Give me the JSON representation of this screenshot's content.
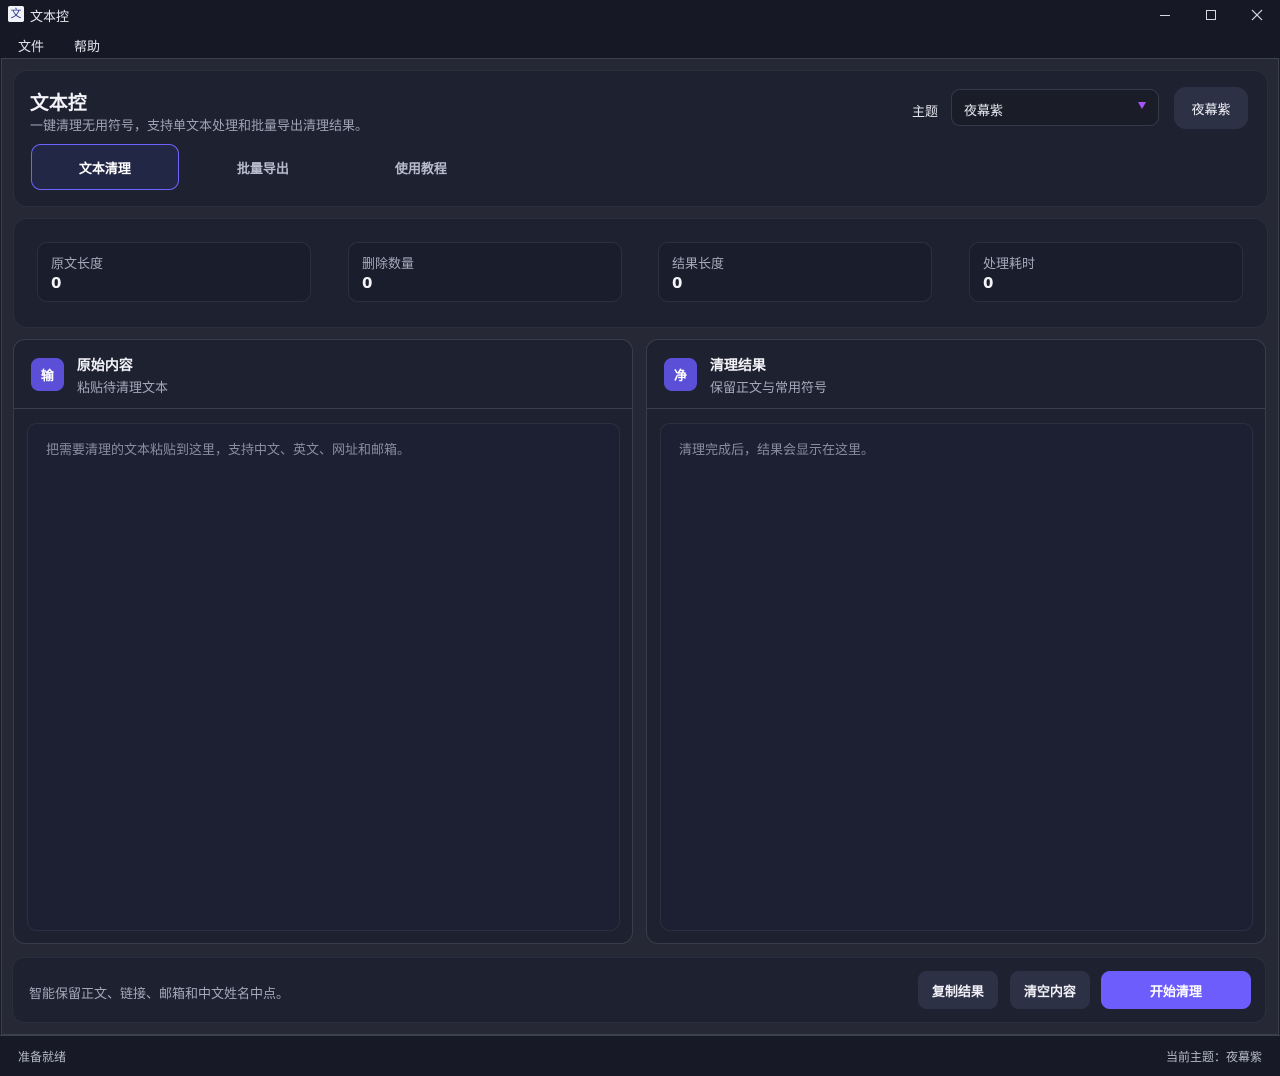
{
  "window": {
    "title": "文本控",
    "icon_glyph": "文"
  },
  "menu": {
    "items": [
      "文件",
      "帮助"
    ]
  },
  "header": {
    "title": "文本控",
    "subtitle": "一键清理无用符号，支持单文本处理和批量导出清理结果。",
    "theme_label": "主题",
    "theme_value": "夜幕紫",
    "theme_button": "夜幕紫",
    "tabs": [
      {
        "label": "文本清理",
        "active": true
      },
      {
        "label": "批量导出",
        "active": false
      },
      {
        "label": "使用教程",
        "active": false
      }
    ]
  },
  "stats": [
    {
      "label": "原文长度",
      "value": "0"
    },
    {
      "label": "删除数量",
      "value": "0"
    },
    {
      "label": "结果长度",
      "value": "0"
    },
    {
      "label": "处理耗时",
      "value": "0"
    }
  ],
  "input_panel": {
    "badge": "输",
    "title": "原始内容",
    "subtitle": "粘贴待清理文本",
    "placeholder": "把需要清理的文本粘贴到这里，支持中文、英文、网址和邮箱。"
  },
  "output_panel": {
    "badge": "净",
    "title": "清理结果",
    "subtitle": "保留正文与常用符号",
    "placeholder": "清理完成后，结果会显示在这里。"
  },
  "footer": {
    "hint": "智能保留正文、链接、邮箱和中文姓名中点。",
    "copy_label": "复制结果",
    "clear_label": "清空内容",
    "start_label": "开始清理"
  },
  "status": {
    "left": "准备就绪",
    "right": "当前主题：夜幕紫"
  },
  "colors": {
    "accent": "#6d5dfc",
    "badge": "#5b4fd8",
    "arrow": "#a855f7",
    "background": "#1b1d2a"
  }
}
